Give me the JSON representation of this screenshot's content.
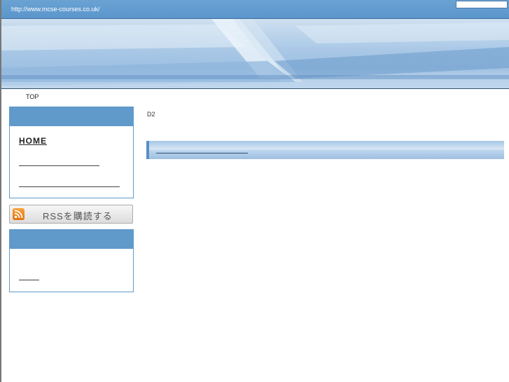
{
  "header": {
    "site_url": "http://www.mcse-courses.co.uk/",
    "search_value": ""
  },
  "breadcrumb": {
    "label": "TOP"
  },
  "sidebar": {
    "nav": {
      "home_label": "HOME"
    },
    "rss": {
      "label": "RSSを購読する",
      "icon": "rss-feed-icon",
      "icon_color": "#f28a1e"
    }
  },
  "main": {
    "label": "D2"
  },
  "colors": {
    "accent": "#5f9acb",
    "topbar": "#6aa2d3"
  }
}
